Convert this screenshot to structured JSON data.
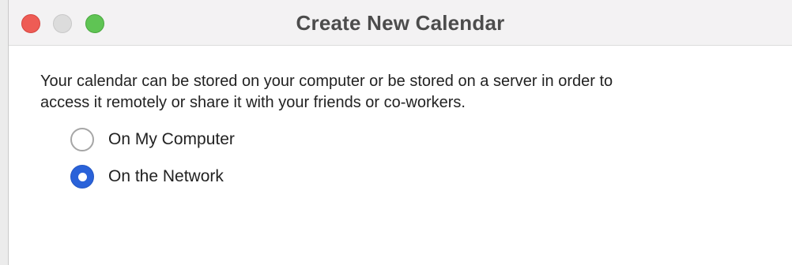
{
  "window": {
    "title": "Create New Calendar"
  },
  "content": {
    "description_line1": "Your calendar can be stored on your computer or be stored on a server in order to",
    "description_line2": "access it remotely or share it with your friends or co-workers.",
    "options": [
      {
        "label": "On My Computer",
        "selected": false
      },
      {
        "label": "On the Network",
        "selected": true
      }
    ]
  },
  "colors": {
    "accent": "#2a62d9",
    "close": "#ee5c55",
    "minimize_disabled": "#dcdcdc",
    "zoom": "#5fc454"
  }
}
